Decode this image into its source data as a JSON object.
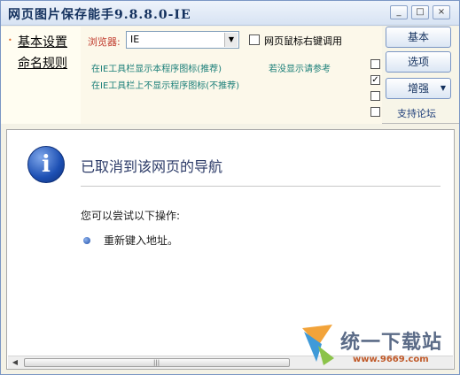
{
  "window": {
    "title": "网页图片保存能手9.8.8.0-IE"
  },
  "titlebar_buttons": {
    "minimize": "_",
    "maximize": "□",
    "close": "×"
  },
  "nav": {
    "bullet": "•",
    "basic": "基本设置",
    "rules": "命名规则"
  },
  "settings": {
    "browser_label": "浏览器:",
    "browser_value": "IE",
    "rightclick_label": "网页鼠标右键调用",
    "show_icon_link": "在IE工具栏显示本程序图标(推荐)",
    "not_shown_link": "若没显示请参考",
    "hide_icon_link": "在IE工具栏上不显示程序图标(不推荐)",
    "checkbox_states": [
      false,
      true,
      false,
      false
    ]
  },
  "side_buttons": {
    "basic": "基本",
    "options": "选项",
    "enhance": "增强",
    "forum": "支持论坛"
  },
  "page": {
    "heading": "已取消到该网页的导航",
    "try_text": "您可以尝试以下操作:",
    "bullet_item": "重新键入地址。"
  },
  "watermark": {
    "text": "统一下载站",
    "url": "www.9669.com"
  },
  "icons": [
    "info-icon",
    "dropdown-arrow-icon",
    "checkbox-icon",
    "bullet-icon",
    "scroll-left-arrow-icon",
    "logo-icon"
  ],
  "colors": {
    "title": "#14315e",
    "link_green": "#1b7f79",
    "browser_label": "#c0392b",
    "heading": "#2b3a67"
  }
}
